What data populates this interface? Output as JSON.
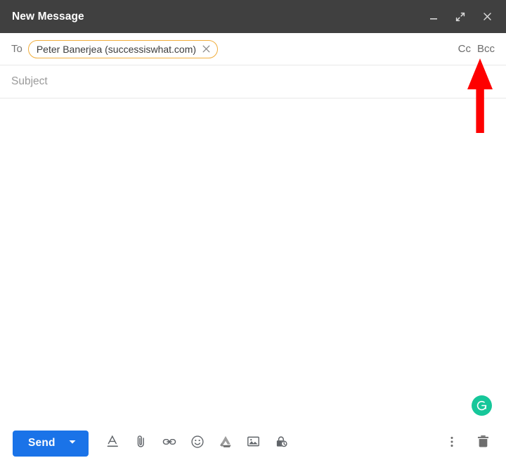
{
  "window": {
    "title": "New Message",
    "controls": [
      {
        "name": "minimize",
        "icon": "minimize-icon",
        "label": "–"
      },
      {
        "name": "expand",
        "icon": "expand-icon",
        "label": "↗"
      },
      {
        "name": "close",
        "icon": "close-icon",
        "label": "×"
      }
    ]
  },
  "fields": {
    "to": {
      "label": "To",
      "recipients": [
        {
          "display": "Peter Banerjea (successiswhat.com)",
          "remove_icon": "close-icon"
        }
      ],
      "cc_label": "Cc",
      "bcc_label": "Bcc"
    },
    "subject": {
      "placeholder": "Subject",
      "value": ""
    },
    "body": {
      "value": "",
      "placeholder": ""
    }
  },
  "grammarly": {
    "icon": "grammarly-icon",
    "label": "G"
  },
  "toolbar": {
    "send_label": "Send",
    "send_caret_icon": "chevron-down-icon",
    "tools": [
      {
        "name": "formatting-options",
        "icon": "format-text-icon",
        "title": "Formatting options"
      },
      {
        "name": "attach-files",
        "icon": "paperclip-icon",
        "title": "Attach files"
      },
      {
        "name": "insert-link",
        "icon": "link-icon",
        "title": "Insert link"
      },
      {
        "name": "insert-emoji",
        "icon": "emoji-icon",
        "title": "Insert emoji"
      },
      {
        "name": "insert-drive-file",
        "icon": "google-drive-icon",
        "title": "Insert files using Drive"
      },
      {
        "name": "insert-photo",
        "icon": "image-icon",
        "title": "Insert photo"
      },
      {
        "name": "confidential-mode",
        "icon": "lock-clock-icon",
        "title": "Toggle confidential mode"
      }
    ],
    "more_options": {
      "name": "more-options",
      "icon": "more-vert-icon",
      "title": "More options"
    },
    "discard": {
      "name": "discard-draft",
      "icon": "trash-icon",
      "title": "Discard draft"
    }
  },
  "annotation": {
    "arrow_color": "#fe0000",
    "points_at": "Bcc"
  },
  "colors": {
    "titlebar_bg": "#404040",
    "send_blue": "#1a73e8",
    "chip_border": "#f0ad3c",
    "grammarly_green": "#16c79a",
    "arrow_red": "#fe0000"
  }
}
